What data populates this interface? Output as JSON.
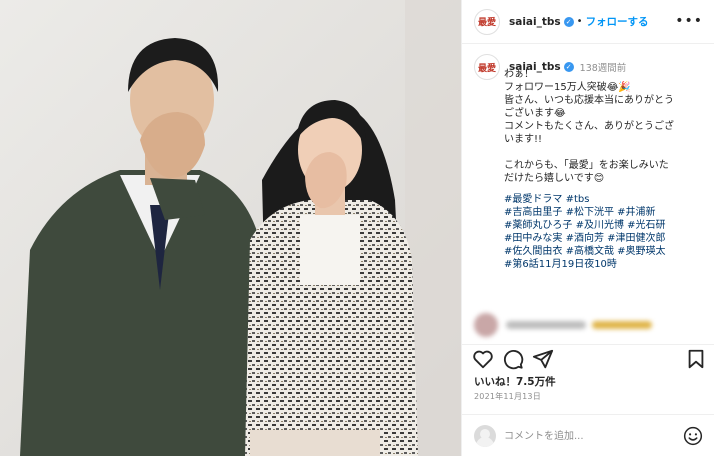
{
  "post": {
    "username": "saiai_tbs",
    "avatar_text": "最愛",
    "verified_mark": "✓",
    "separator": "•",
    "follow_label": "フォローする",
    "more_label": "•••"
  },
  "caption": {
    "username": "saiai_tbs",
    "time_ago": "138週間前",
    "body": "わぁ！\nフォロワー15万人突破😂🎉\n皆さん、いつも応援本当にありがとう\nございます😂\nコメントもたくさん、ありがとうござ\nいます!!\n\nこれからも、「最愛」をお楽しみいた\nだけたら嬉しいです😊",
    "hashtags": [
      "#最愛ドラマ",
      "#tbs",
      "#吉高由里子",
      "#松下洸平",
      "#井浦新",
      "#薬師丸ひろ子",
      "#及川光博",
      "#光石研",
      "#田中みな実",
      "#酒向芳",
      "#津田健次郎",
      "#佐久間由衣",
      "#高橋文哉",
      "#奥野瑛太",
      "#第6話11月19日夜10時"
    ]
  },
  "actions": {
    "icons": [
      "heart-icon",
      "comment-icon",
      "share-icon",
      "bookmark-icon"
    ]
  },
  "likes_text": "いいね！7.5万件",
  "date_text": "2021年11月13日",
  "comment": {
    "placeholder": "コメントを追加...",
    "emoji_icon": "smiley-icon"
  },
  "colors": {
    "accent": "#0095f6",
    "hashtag": "#00376b",
    "verified": "#3897f0",
    "brand_red": "#c0392b"
  }
}
